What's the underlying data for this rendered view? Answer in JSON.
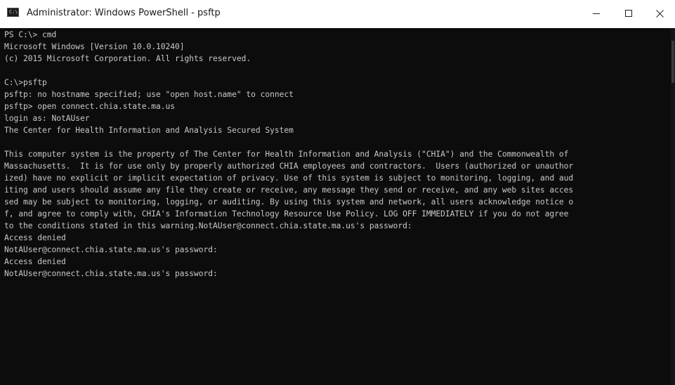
{
  "window": {
    "title": "Administrator: Windows PowerShell - psftp",
    "icon": "console-icon",
    "controls": [
      "minimize-icon",
      "maximize-icon",
      "close-icon"
    ]
  },
  "colors": {
    "console_bg": "#0c0c0c",
    "console_text": "#c8c8c8",
    "titlebar_bg": "#ffffff"
  },
  "console": {
    "lines": [
      "PS C:\\> cmd",
      "Microsoft Windows [Version 10.0.10240]",
      "(c) 2015 Microsoft Corporation. All rights reserved.",
      "",
      "C:\\>psftp",
      "psftp: no hostname specified; use \"open host.name\" to connect",
      "psftp> open connect.chia.state.ma.us",
      "login as: NotAUser",
      "The Center for Health Information and Analysis Secured System",
      "",
      "This computer system is the property of The Center for Health Information and Analysis (\"CHIA\") and the Commonwealth of",
      "Massachusetts.  It is for use only by properly authorized CHIA employees and contractors.  Users (authorized or unauthor",
      "ized) have no explicit or implicit expectation of privacy. Use of this system is subject to monitoring, logging, and aud",
      "iting and users should assume any file they create or receive, any message they send or receive, and any web sites acces",
      "sed may be subject to monitoring, logging, or auditing. By using this system and network, all users acknowledge notice o",
      "f, and agree to comply with, CHIA's Information Technology Resource Use Policy. LOG OFF IMMEDIATELY if you do not agree",
      "to the conditions stated in this warning.NotAUser@connect.chia.state.ma.us's password:",
      "Access denied",
      "NotAUser@connect.chia.state.ma.us's password:",
      "Access denied",
      "NotAUser@connect.chia.state.ma.us's password:"
    ]
  }
}
